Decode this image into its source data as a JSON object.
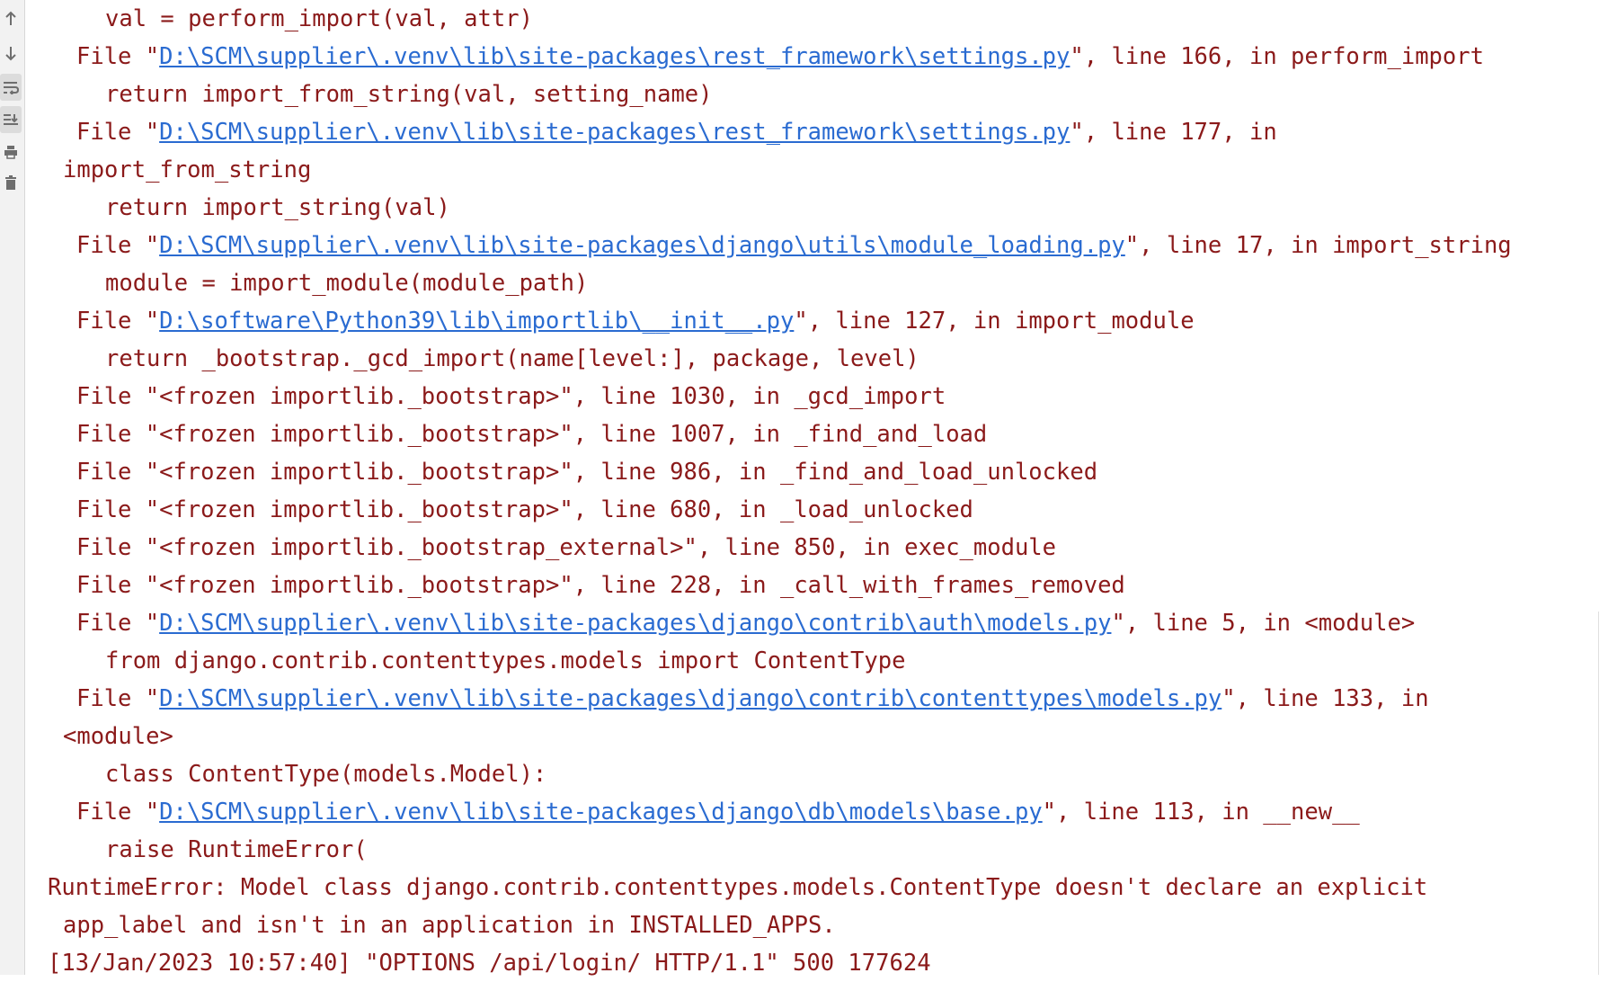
{
  "gutter": {
    "buttons": [
      {
        "name": "up-arrow-icon",
        "active": false
      },
      {
        "name": "down-arrow-icon",
        "active": false
      },
      {
        "name": "soft-wrap-icon",
        "active": true
      },
      {
        "name": "scroll-to-end-icon",
        "active": true
      },
      {
        "name": "print-icon",
        "active": false
      },
      {
        "name": "trash-icon",
        "active": false
      }
    ]
  },
  "console": {
    "lines": [
      {
        "indent": 2,
        "segments": [
          {
            "t": "val = perform_import(val, attr)"
          }
        ]
      },
      {
        "indent": 1,
        "segments": [
          {
            "t": "File \""
          },
          {
            "t": "D:\\SCM\\supplier\\.venv\\lib\\site-packages\\rest_framework\\settings.py",
            "link": true
          },
          {
            "t": "\", line 166, in perform_import"
          }
        ]
      },
      {
        "indent": 2,
        "segments": [
          {
            "t": "return import_from_string(val, setting_name)"
          }
        ]
      },
      {
        "indent": 1,
        "segments": [
          {
            "t": "File \""
          },
          {
            "t": "D:\\SCM\\supplier\\.venv\\lib\\site-packages\\rest_framework\\settings.py",
            "link": true
          },
          {
            "t": "\", line 177, in"
          }
        ]
      },
      {
        "indent": 0,
        "segments": [
          {
            "t": "import_from_string"
          }
        ]
      },
      {
        "indent": 2,
        "segments": [
          {
            "t": "return import_string(val)"
          }
        ]
      },
      {
        "indent": 1,
        "segments": [
          {
            "t": "File \""
          },
          {
            "t": "D:\\SCM\\supplier\\.venv\\lib\\site-packages\\django\\utils\\module_loading.py",
            "link": true
          },
          {
            "t": "\", line 17, in import_string"
          }
        ]
      },
      {
        "indent": 2,
        "segments": [
          {
            "t": "module = import_module(module_path)"
          }
        ]
      },
      {
        "indent": 1,
        "segments": [
          {
            "t": "File \""
          },
          {
            "t": "D:\\software\\Python39\\lib\\importlib\\__init__.py",
            "link": true
          },
          {
            "t": "\", line 127, in import_module"
          }
        ]
      },
      {
        "indent": 2,
        "segments": [
          {
            "t": "return _bootstrap._gcd_import(name[level:], package, level)"
          }
        ]
      },
      {
        "indent": 1,
        "segments": [
          {
            "t": "File \"<frozen importlib._bootstrap>\", line 1030, in _gcd_import"
          }
        ]
      },
      {
        "indent": 1,
        "segments": [
          {
            "t": "File \"<frozen importlib._bootstrap>\", line 1007, in _find_and_load"
          }
        ]
      },
      {
        "indent": 1,
        "segments": [
          {
            "t": "File \"<frozen importlib._bootstrap>\", line 986, in _find_and_load_unlocked"
          }
        ]
      },
      {
        "indent": 1,
        "segments": [
          {
            "t": "File \"<frozen importlib._bootstrap>\", line 680, in _load_unlocked"
          }
        ]
      },
      {
        "indent": 1,
        "segments": [
          {
            "t": "File \"<frozen importlib._bootstrap_external>\", line 850, in exec_module"
          }
        ]
      },
      {
        "indent": 1,
        "segments": [
          {
            "t": "File \"<frozen importlib._bootstrap>\", line 228, in _call_with_frames_removed"
          }
        ]
      },
      {
        "indent": 1,
        "segments": [
          {
            "t": "File \""
          },
          {
            "t": "D:\\SCM\\supplier\\.venv\\lib\\site-packages\\django\\contrib\\auth\\models.py",
            "link": true
          },
          {
            "t": "\", line 5, in <module>"
          }
        ]
      },
      {
        "indent": 2,
        "segments": [
          {
            "t": "from django.contrib.contenttypes.models import ContentType"
          }
        ]
      },
      {
        "indent": 1,
        "segments": [
          {
            "t": "File \""
          },
          {
            "t": "D:\\SCM\\supplier\\.venv\\lib\\site-packages\\django\\contrib\\contenttypes\\models.py",
            "link": true
          },
          {
            "t": "\", line 133, in"
          }
        ]
      },
      {
        "indent": 0,
        "segments": [
          {
            "t": "<module>"
          }
        ]
      },
      {
        "indent": 2,
        "segments": [
          {
            "t": "class ContentType(models.Model):"
          }
        ]
      },
      {
        "indent": 1,
        "segments": [
          {
            "t": "File \""
          },
          {
            "t": "D:\\SCM\\supplier\\.venv\\lib\\site-packages\\django\\db\\models\\base.py",
            "link": true
          },
          {
            "t": "\", line 113, in __new__"
          }
        ]
      },
      {
        "indent": 2,
        "segments": [
          {
            "t": "raise RuntimeError("
          }
        ]
      },
      {
        "indent": -1,
        "segments": [
          {
            "t": "RuntimeError: Model class django.contrib.contenttypes.models.ContentType doesn't declare an explicit"
          }
        ]
      },
      {
        "indent": 0,
        "segments": [
          {
            "t": "app_label and isn't in an application in INSTALLED_APPS."
          }
        ]
      },
      {
        "indent": -1,
        "segments": [
          {
            "t": "[13/Jan/2023 10:57:40] \"OPTIONS /api/login/ HTTP/1.1\" 500 177624"
          }
        ]
      }
    ]
  }
}
